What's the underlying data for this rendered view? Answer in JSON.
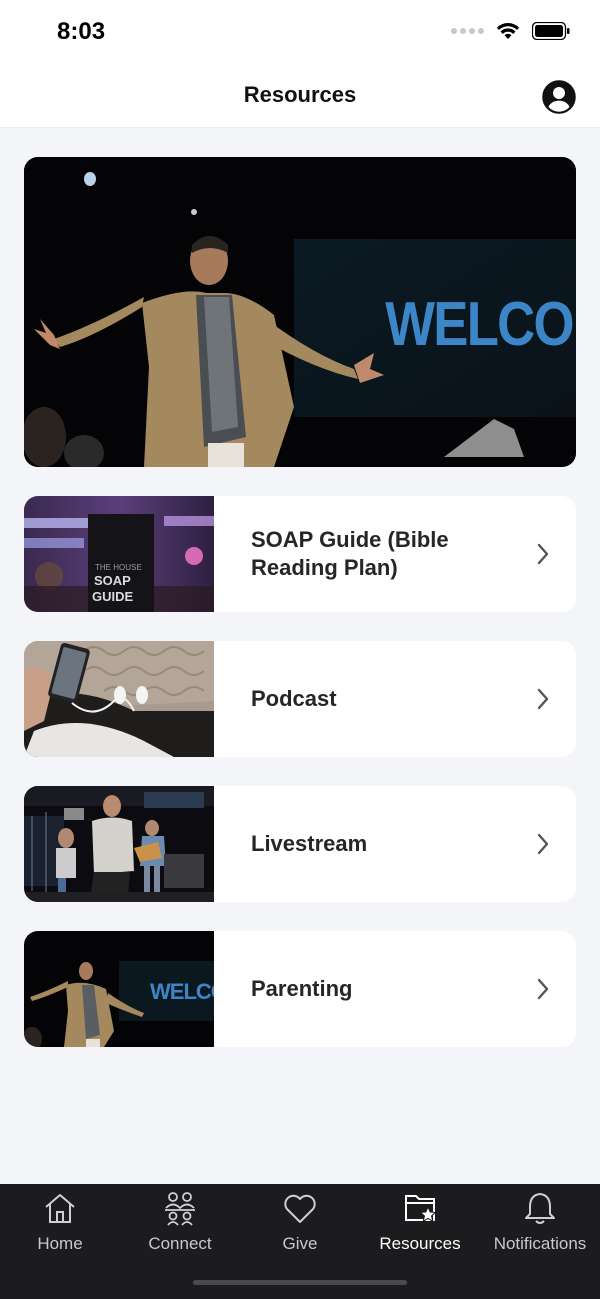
{
  "status": {
    "time": "8:03"
  },
  "nav": {
    "title": "Resources"
  },
  "rows": [
    {
      "label": "SOAP Guide (Bible Reading Plan)",
      "thumb_text_small": "THE HOUSE",
      "thumb_text_big1": "SOAP",
      "thumb_text_big2": "GUIDE"
    },
    {
      "label": "Podcast"
    },
    {
      "label": "Livestream"
    },
    {
      "label": "Parenting",
      "thumb_text": "WELCOME"
    }
  ],
  "hero": {
    "screen_text": "WELCOME"
  },
  "tabs": [
    {
      "label": "Home",
      "icon": "home-icon"
    },
    {
      "label": "Connect",
      "icon": "connect-icon"
    },
    {
      "label": "Give",
      "icon": "heart-icon"
    },
    {
      "label": "Resources",
      "icon": "resources-icon",
      "active": true
    },
    {
      "label": "Notifications",
      "icon": "bell-icon"
    }
  ],
  "colors": {
    "background": "#f4f5f9",
    "tab_bar": "#1c1c1e",
    "card": "#ffffff",
    "accent_blue": "#3a7bd5"
  }
}
